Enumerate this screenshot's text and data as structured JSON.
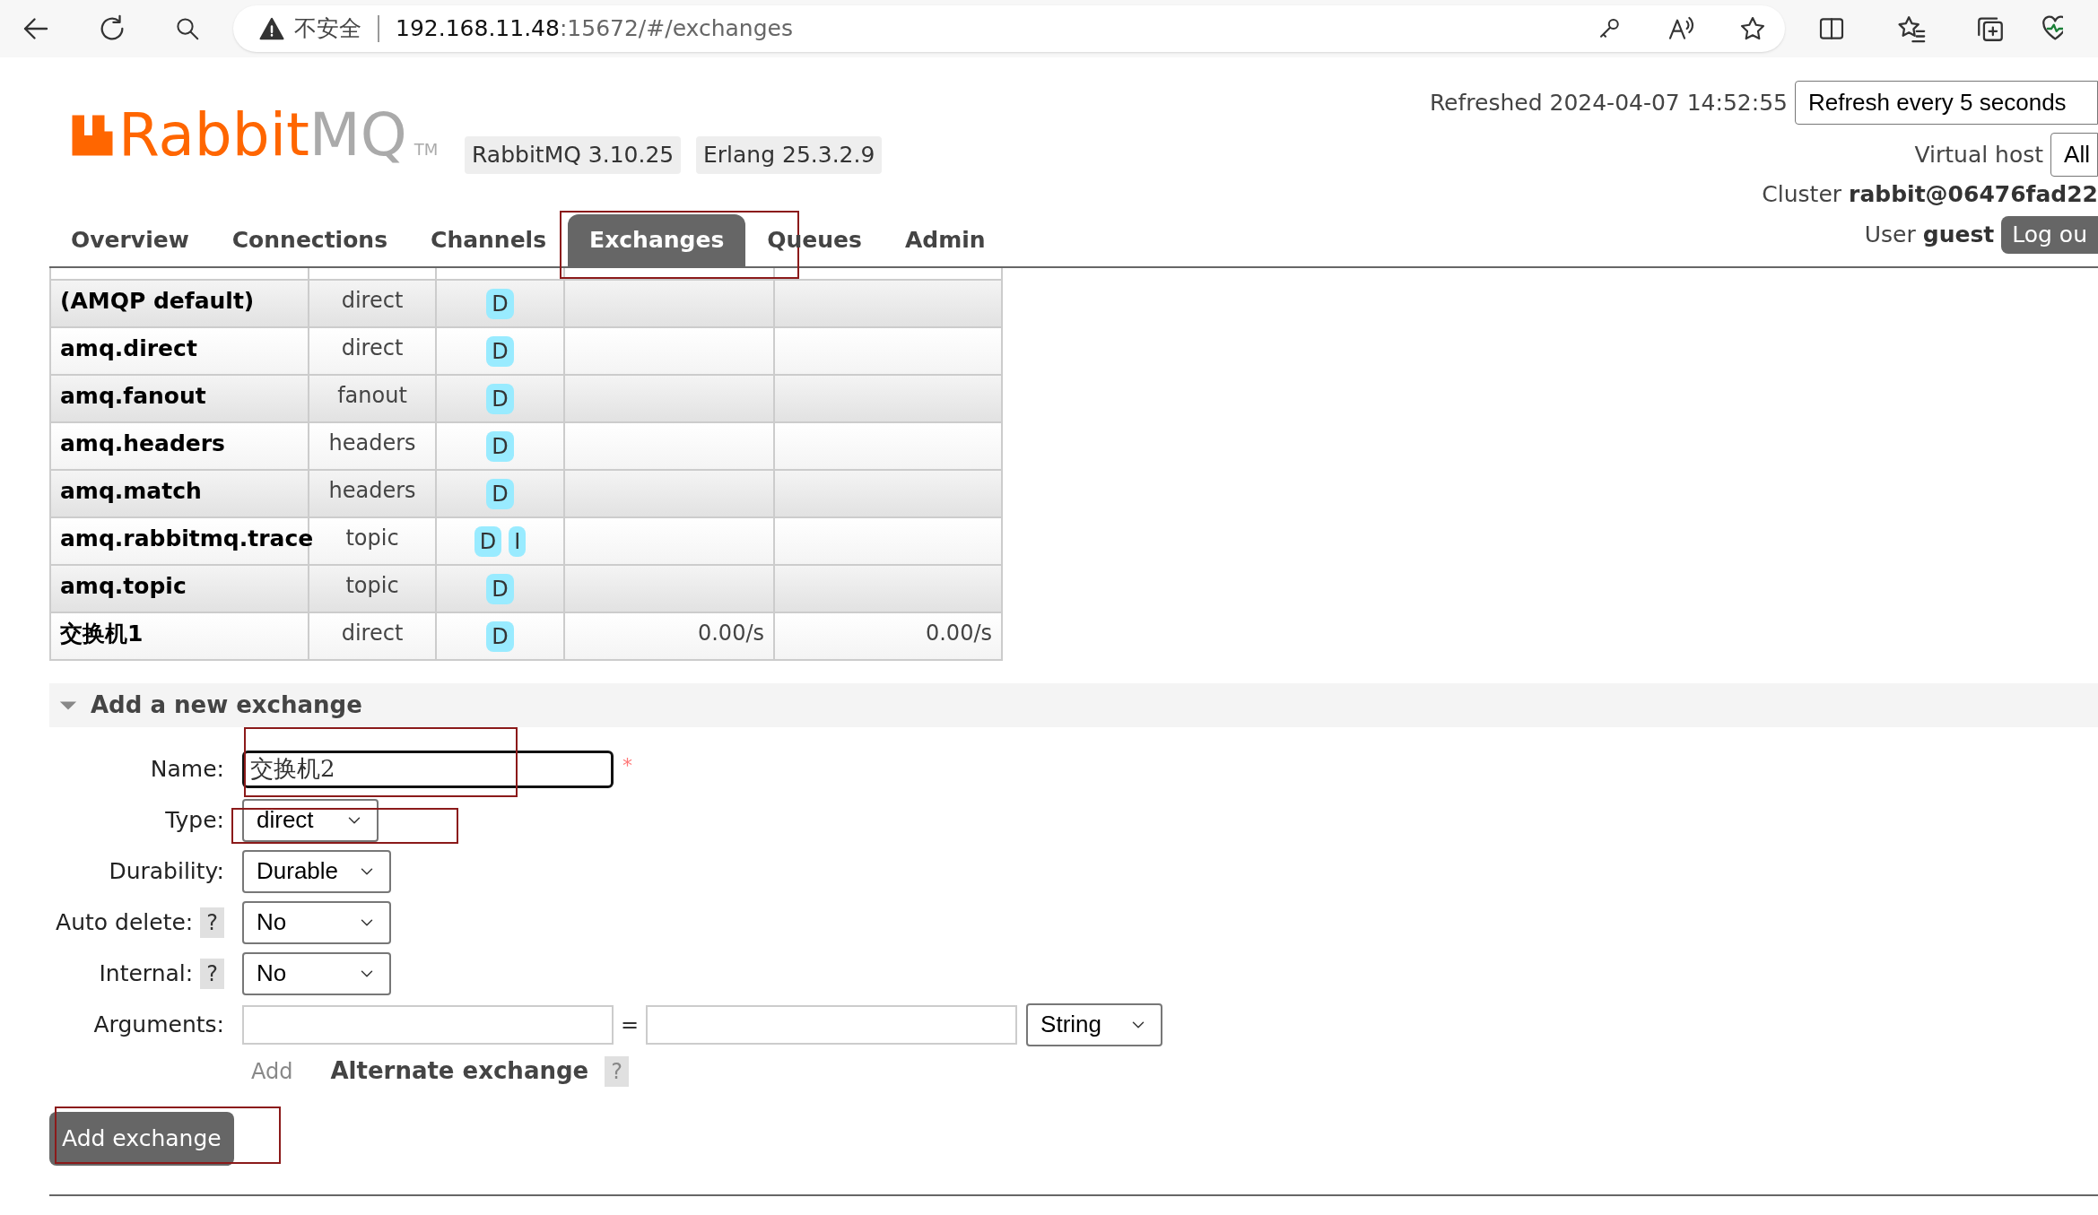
{
  "browser": {
    "security": "不安全",
    "url_host": "192.168.11.48",
    "url_rest": ":15672/#/exchanges"
  },
  "header": {
    "logo_primary": "Rabbit",
    "logo_secondary": "MQ",
    "trademark": "TM",
    "version": "RabbitMQ 3.10.25",
    "erlang": "Erlang 25.3.2.9",
    "refreshed": "Refreshed 2024-04-07 14:52:55",
    "refresh_select": "Refresh every 5 seconds",
    "vhost_label": "Virtual host",
    "vhost_select": "All",
    "cluster_label": "Cluster",
    "cluster_name": "rabbit@06476fad22",
    "user_label": "User",
    "user_name": "guest",
    "logout": "Log ou"
  },
  "tabs": [
    {
      "label": "Overview",
      "selected": false,
      "annotated": false
    },
    {
      "label": "Connections",
      "selected": false,
      "annotated": false
    },
    {
      "label": "Channels",
      "selected": false,
      "annotated": false
    },
    {
      "label": "Exchanges",
      "selected": true,
      "annotated": true
    },
    {
      "label": "Queues",
      "selected": false,
      "annotated": false
    },
    {
      "label": "Admin",
      "selected": false,
      "annotated": false
    }
  ],
  "table": {
    "rows": [
      {
        "name": "(AMQP default)",
        "type": "direct",
        "features": [
          "D"
        ],
        "rate_in": "",
        "rate_out": ""
      },
      {
        "name": "amq.direct",
        "type": "direct",
        "features": [
          "D"
        ]
      },
      {
        "name": "amq.fanout",
        "type": "fanout",
        "features": [
          "D"
        ]
      },
      {
        "name": "amq.headers",
        "type": "headers",
        "features": [
          "D"
        ]
      },
      {
        "name": "amq.match",
        "type": "headers",
        "features": [
          "D"
        ]
      },
      {
        "name": "amq.rabbitmq.trace",
        "type": "topic",
        "features": [
          "D",
          "I"
        ]
      },
      {
        "name": "amq.topic",
        "type": "topic",
        "features": [
          "D"
        ]
      },
      {
        "name": "交换机1",
        "type": "direct",
        "features": [
          "D"
        ],
        "rate_in": "0.00/s",
        "rate_out": "0.00/s"
      }
    ]
  },
  "form": {
    "title": "Add a new exchange",
    "expanded": true,
    "fields": [
      {
        "kind": "text",
        "label": "Name:",
        "value": "交换机2",
        "required": true,
        "required_mark": "*",
        "annotated": true
      },
      {
        "kind": "select",
        "label": "Type:",
        "value": "direct",
        "annotated": true
      },
      {
        "kind": "select",
        "label": "Durability:",
        "value": "Durable",
        "annotated": false
      },
      {
        "kind": "select",
        "label": "Auto delete:",
        "value": "No",
        "help": "?",
        "annotated": false
      },
      {
        "kind": "select",
        "label": "Internal:",
        "value": "No",
        "help": "?",
        "annotated": false
      },
      {
        "kind": "arguments",
        "label": "Arguments:",
        "equals": "=",
        "value": "String",
        "annotated": false
      }
    ],
    "add_link": "Add",
    "alternate": "Alternate exchange",
    "alternate_help": "?",
    "submit": "Add exchange",
    "submit_annotated": true
  }
}
